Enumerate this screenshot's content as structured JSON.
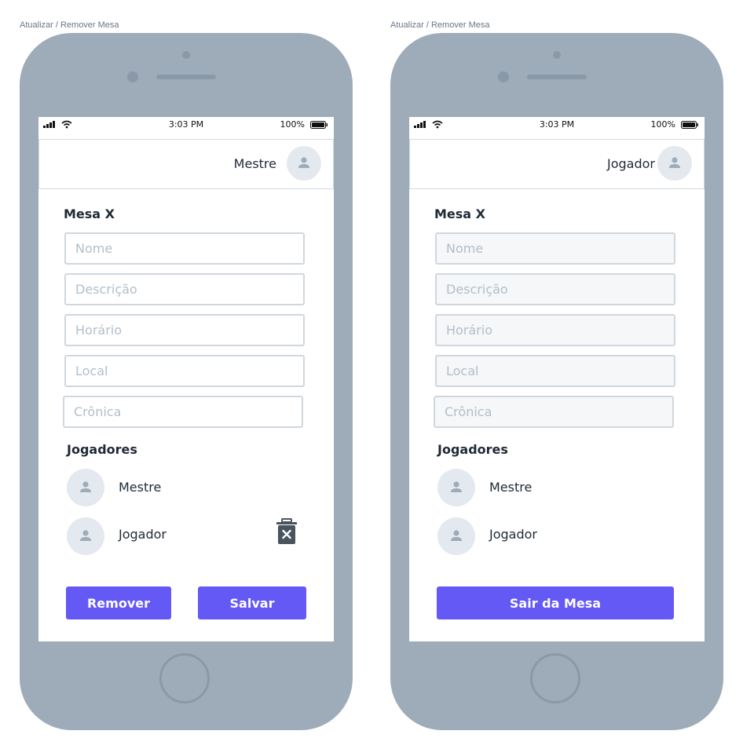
{
  "colors": {
    "phone_body": "#9eacb9",
    "accent": "#6459f5",
    "text": "#1f2a37",
    "placeholder": "#b3bec9",
    "border": "#d0d7de",
    "avatar_bg": "#e4e9ef",
    "trash_icon": "#4a545e"
  },
  "screens": [
    {
      "artboard_label": "Atualizar / Remover Mesa",
      "status_bar": {
        "time": "3:03 PM",
        "battery": "100%"
      },
      "header": {
        "user_name": "Mestre"
      },
      "table_title": "Mesa X",
      "fields": {
        "name": "Nome",
        "description": "Descrição",
        "schedule": "Horário",
        "location": "Local",
        "chronicle": "Crônica"
      },
      "players_title": "Jogadores",
      "players": [
        {
          "name": "Mestre"
        },
        {
          "name": "Jogador"
        }
      ],
      "icons": [
        "signal-icon",
        "wifi-icon",
        "battery-icon",
        "user-icon",
        "trash-icon"
      ],
      "buttons": {
        "remove": "Remover",
        "save": "Salvar"
      }
    },
    {
      "artboard_label": "Atualizar / Remover Mesa",
      "status_bar": {
        "time": "3:03 PM",
        "battery": "100%"
      },
      "header": {
        "user_name": "Jogador"
      },
      "table_title": "Mesa X",
      "fields": {
        "name": "Nome",
        "description": "Descrição",
        "schedule": "Horário",
        "location": "Local",
        "chronicle": "Crônica"
      },
      "players_title": "Jogadores",
      "players": [
        {
          "name": "Mestre"
        },
        {
          "name": "Jogador"
        }
      ],
      "icons": [
        "signal-icon",
        "wifi-icon",
        "battery-icon",
        "user-icon"
      ],
      "buttons": {
        "leave": "Sair da Mesa"
      }
    }
  ]
}
